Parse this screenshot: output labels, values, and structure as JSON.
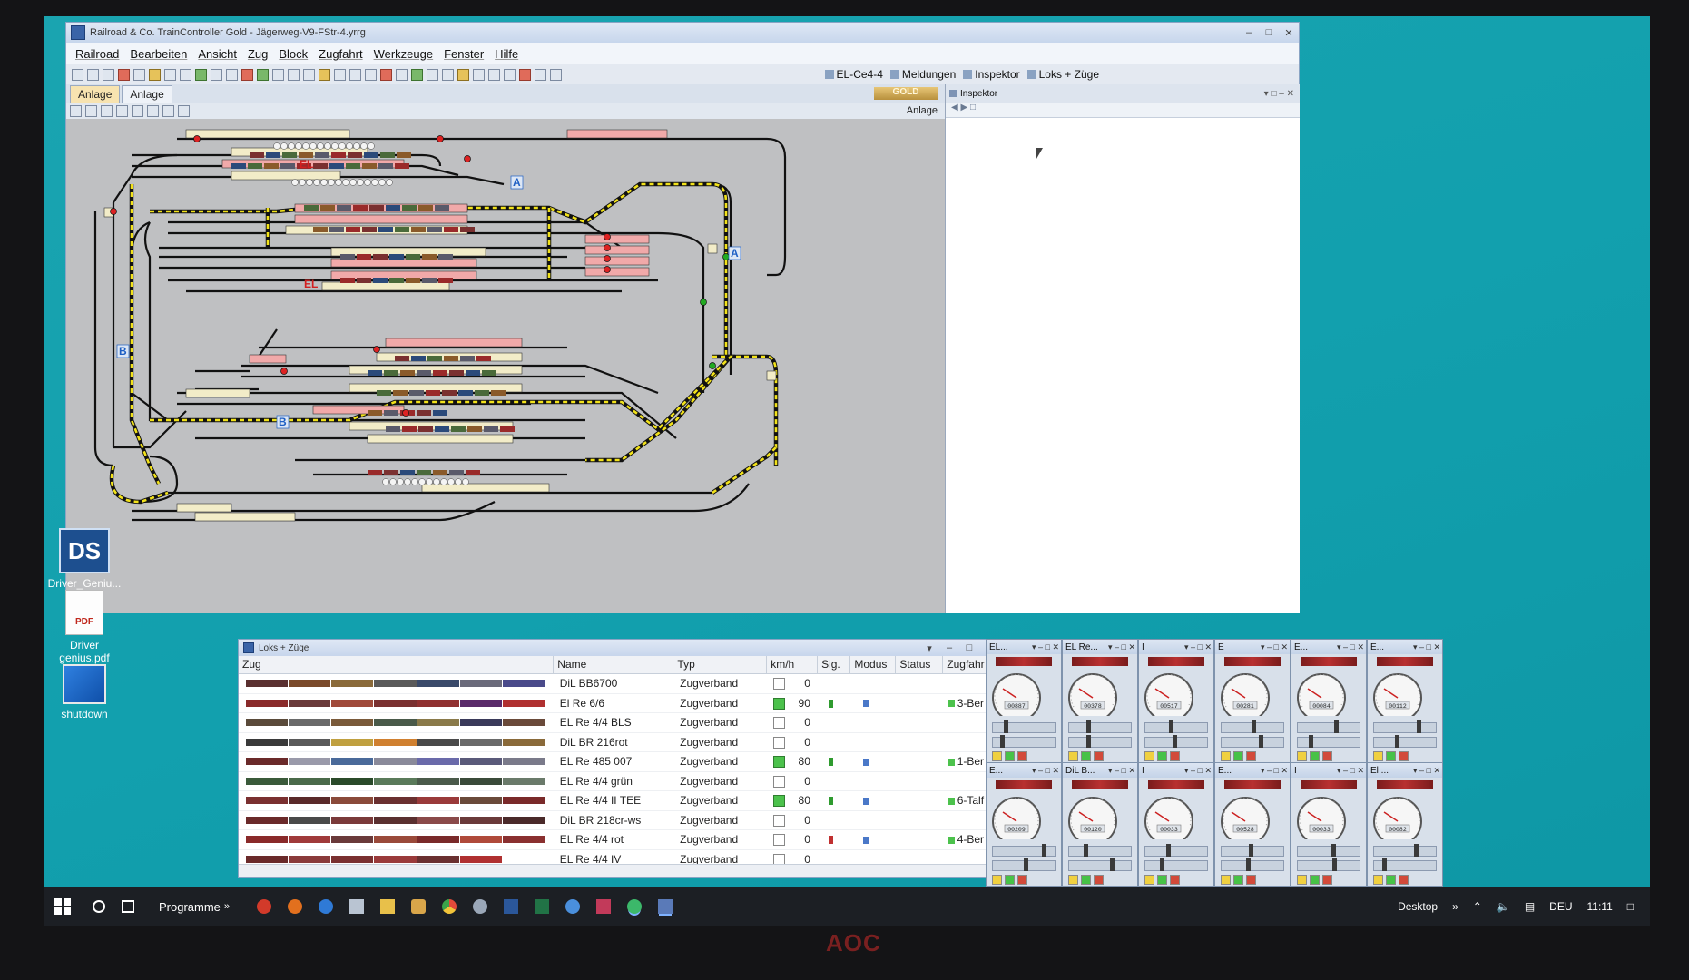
{
  "window": {
    "title": "Railroad & Co. TrainController Gold - Jägerweg-V9-FStr-4.yrrg",
    "menu": [
      "Railroad",
      "Bearbeiten",
      "Ansicht",
      "Zug",
      "Block",
      "Zugfahrt",
      "Werkzeuge",
      "Fenster",
      "Hilfe"
    ],
    "toolbar_tabs": [
      "EL-Ce4-4",
      "Meldungen",
      "Inspektor",
      "Loks + Züge"
    ],
    "subtabs": [
      "Anlage",
      "Anlage"
    ],
    "gold_badge": "GOLD",
    "pane_label": "Anlage"
  },
  "inspector": {
    "title": "Inspektor"
  },
  "trackplan": {
    "labels": [
      {
        "text": "A",
        "color": "#1e5fc4"
      },
      {
        "text": "A",
        "color": "#1e5fc4"
      },
      {
        "text": "B",
        "color": "#1e5fc4"
      },
      {
        "text": "B",
        "color": "#1e5fc4"
      },
      {
        "text": "EL",
        "color": "#d22020"
      },
      {
        "text": "EL",
        "color": "#d22020"
      }
    ],
    "colors": {
      "background": "#bfc0c2",
      "track": "#111111",
      "route": "#f2e21a",
      "occupied": "#f1a9a9",
      "free_block": "#f2ecc8"
    }
  },
  "desktop_icons": [
    {
      "label": "Driver_Geniu...",
      "icon": "ds-icon"
    },
    {
      "label": "Driver genius.pdf",
      "icon": "pdf-icon",
      "badge": "PDF"
    },
    {
      "label": "shutdown",
      "icon": "shutdown-icon"
    }
  ],
  "trains": {
    "title": "Loks + Züge",
    "columns": [
      "Zug",
      "Name",
      "Typ",
      "km/h",
      "Sig.",
      "Modus",
      "Status",
      "Zugfahr"
    ],
    "rows": [
      {
        "name": "DiL BB6700",
        "typ": "Zugverband",
        "kmh": "0",
        "active": false,
        "sig": "",
        "mod": false,
        "zf": ""
      },
      {
        "name": "El Re 6/6",
        "typ": "Zugverband",
        "kmh": "90",
        "active": true,
        "sig": "green",
        "mod": true,
        "zf": "3-Ber"
      },
      {
        "name": "EL Re 4/4 BLS",
        "typ": "Zugverband",
        "kmh": "0",
        "active": false,
        "sig": "",
        "mod": false,
        "zf": ""
      },
      {
        "name": "DiL BR 216rot",
        "typ": "Zugverband",
        "kmh": "0",
        "active": false,
        "sig": "",
        "mod": false,
        "zf": ""
      },
      {
        "name": "EL Re 485 007",
        "typ": "Zugverband",
        "kmh": "80",
        "active": true,
        "sig": "green",
        "mod": true,
        "zf": "1-Ber"
      },
      {
        "name": "EL Re 4/4 grün",
        "typ": "Zugverband",
        "kmh": "0",
        "active": false,
        "sig": "",
        "mod": false,
        "zf": ""
      },
      {
        "name": "EL Re 4/4 II TEE",
        "typ": "Zugverband",
        "kmh": "80",
        "active": true,
        "sig": "green",
        "mod": true,
        "zf": "6-Talf"
      },
      {
        "name": "DiL BR 218cr-ws",
        "typ": "Zugverband",
        "kmh": "0",
        "active": false,
        "sig": "",
        "mod": false,
        "zf": ""
      },
      {
        "name": "EL Re 4/4 rot",
        "typ": "Zugverband",
        "kmh": "0",
        "active": false,
        "sig": "red",
        "mod": true,
        "zf": "4-Ber"
      },
      {
        "name": "EL Re 4/4 IV",
        "typ": "Zugverband",
        "kmh": "0",
        "active": false,
        "sig": "",
        "mod": false,
        "zf": ""
      }
    ]
  },
  "cabs": [
    {
      "title": "EL...",
      "odo": "00887"
    },
    {
      "title": "EL Re...",
      "odo": "00378"
    },
    {
      "title": "I",
      "odo": "00517"
    },
    {
      "title": "E",
      "odo": "00281"
    },
    {
      "title": "E...",
      "odo": "00084"
    },
    {
      "title": "E...",
      "odo": "00112"
    },
    {
      "title": "E...",
      "odo": "00209"
    },
    {
      "title": "DiL B...",
      "odo": "00120"
    },
    {
      "title": "I",
      "odo": "00033"
    },
    {
      "title": "E...",
      "odo": "00528"
    },
    {
      "title": "I",
      "odo": "00033"
    },
    {
      "title": "El ...",
      "odo": "00082"
    }
  ],
  "taskbar": {
    "programs_label": "Programme",
    "desktop_label": "Desktop",
    "lang": "DEU",
    "clock": "11:11"
  },
  "monitor_brand": "AOC"
}
